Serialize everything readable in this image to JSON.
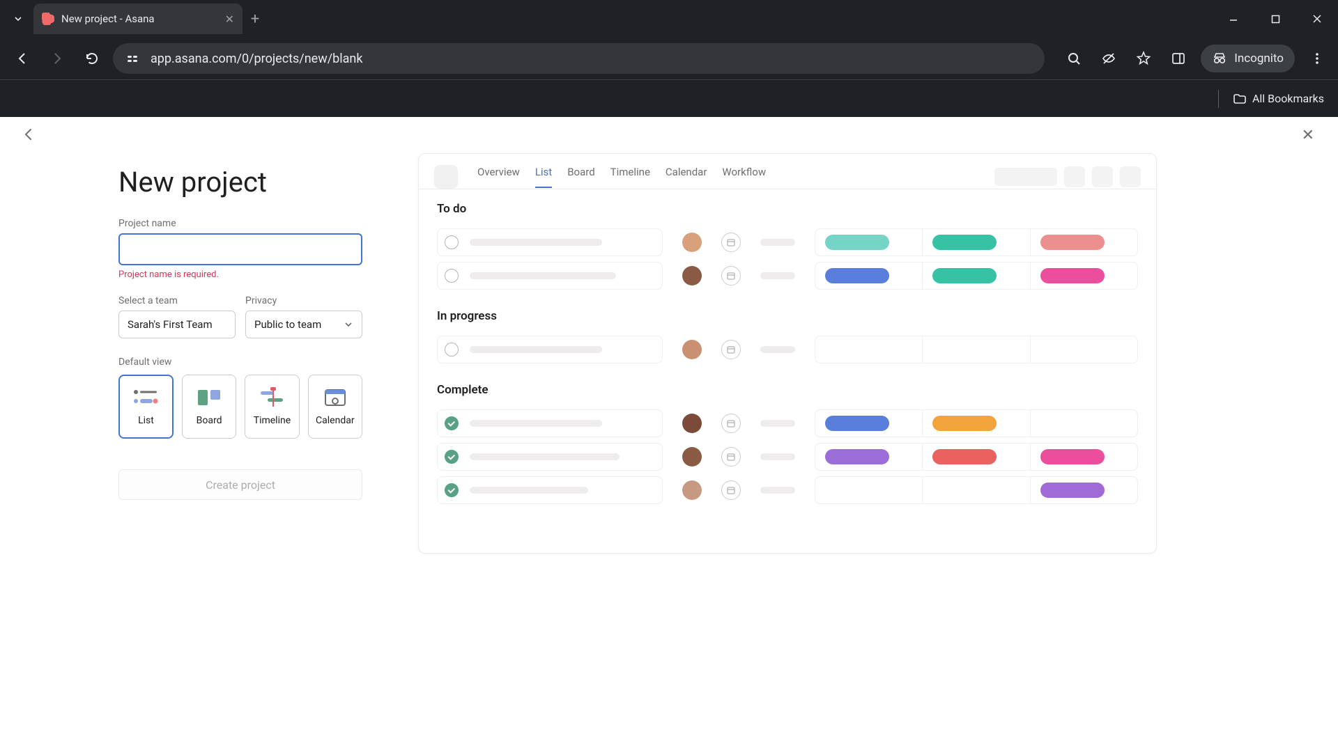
{
  "browser": {
    "tab_title": "New project - Asana",
    "url": "app.asana.com/0/projects/new/blank",
    "incognito_label": "Incognito",
    "all_bookmarks": "All Bookmarks"
  },
  "page": {
    "title": "New project",
    "project_name_label": "Project name",
    "project_name_value": "",
    "project_name_error": "Project name is required.",
    "team_label": "Select a team",
    "team_value": "Sarah's First Team",
    "privacy_label": "Privacy",
    "privacy_value": "Public to team",
    "default_view_label": "Default view",
    "views": {
      "list": "List",
      "board": "Board",
      "timeline": "Timeline",
      "calendar": "Calendar"
    },
    "create_button": "Create project"
  },
  "preview": {
    "tabs": {
      "overview": "Overview",
      "list": "List",
      "board": "Board",
      "timeline": "Timeline",
      "calendar": "Calendar",
      "workflow": "Workflow"
    },
    "sections": {
      "todo": "To do",
      "inprogress": "In progress",
      "complete": "Complete"
    },
    "colors": {
      "teal": "#5bc2b3",
      "green": "#37c2a5",
      "coral": "#ec8f8f",
      "blue": "#5a7edb",
      "pink": "#ea4e9d",
      "orange": "#f1a33c",
      "purple": "#9b6dd7",
      "red": "#ea6160",
      "violet": "#a06bd6"
    },
    "avatars": {
      "a1": "#d9a07c",
      "a2": "#8b5a44",
      "a3": "#c99072",
      "a4": "#7b4a38",
      "a5": "#c79882"
    }
  }
}
